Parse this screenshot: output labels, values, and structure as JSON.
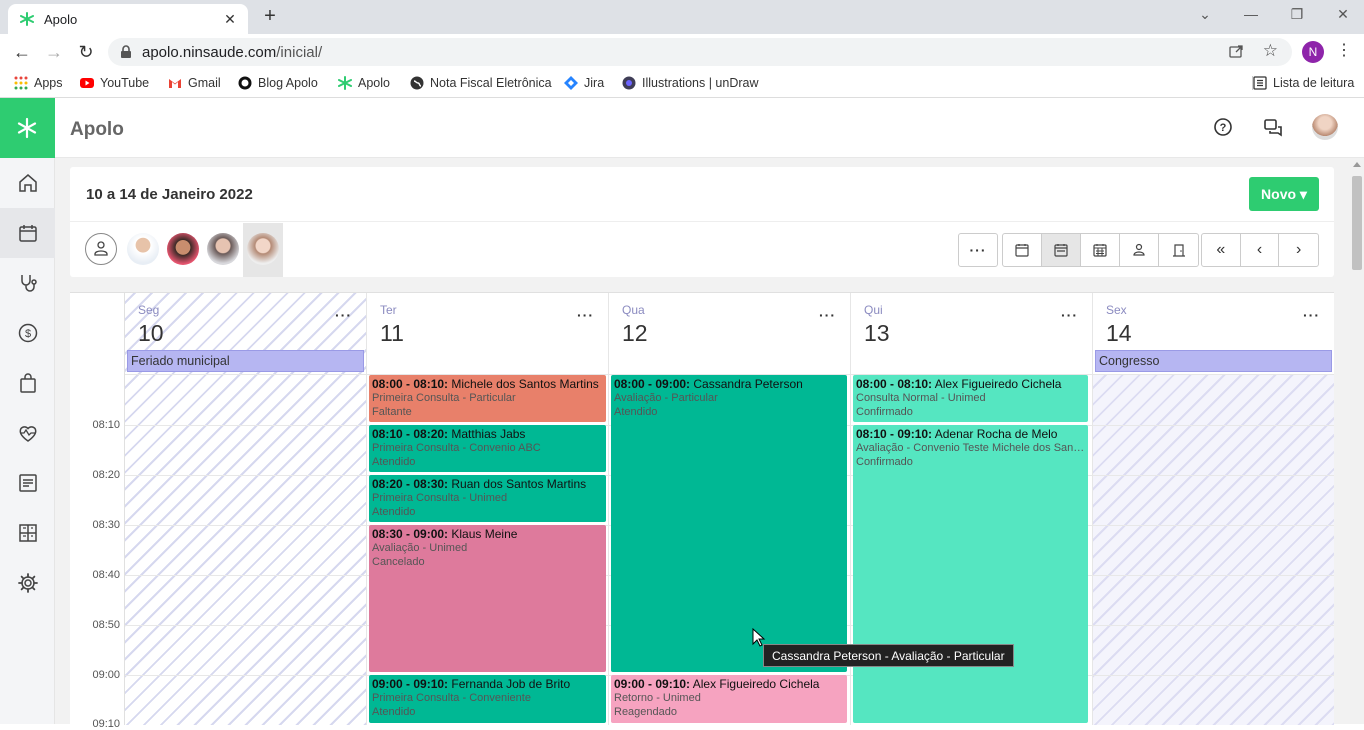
{
  "browser": {
    "tab_title": "Apolo",
    "url_host": "apolo.ninsaude.com",
    "url_path": "/inicial/",
    "profile_initial": "N",
    "bookmarks": [
      "Apps",
      "YouTube",
      "Gmail",
      "Blog Apolo",
      "Apolo",
      "Nota Fiscal Eletrônica",
      "Jira",
      "Illustrations | unDraw"
    ],
    "reading_list": "Lista de leitura"
  },
  "app": {
    "title": "Apolo",
    "brand_color": "#2ecc71"
  },
  "header": {
    "period": "10 a 14 de Janeiro 2022",
    "new_button": "Novo ▾"
  },
  "calendar": {
    "times": [
      "08:10",
      "08:20",
      "08:30",
      "08:40",
      "08:50",
      "09:00",
      "09:10"
    ],
    "days": [
      {
        "name": "Seg",
        "num": "10",
        "allday": "Feriado municipal"
      },
      {
        "name": "Ter",
        "num": "11",
        "allday": ""
      },
      {
        "name": "Qua",
        "num": "12",
        "allday": ""
      },
      {
        "name": "Qui",
        "num": "13",
        "allday": ""
      },
      {
        "name": "Sex",
        "num": "14",
        "allday": "Congresso"
      }
    ],
    "events": [
      {
        "day": 1,
        "time": "08:00 - 08:10:",
        "name": "Michele dos Santos Martins",
        "type": "Primeira Consulta",
        "plan": "Particular",
        "status": "Faltante",
        "color": "#e8806a"
      },
      {
        "day": 1,
        "time": "08:10 - 08:20:",
        "name": "Matthias Jabs",
        "type": "Primeira Consulta",
        "plan": "Convenio ABC",
        "status": "Atendido",
        "color": "#00b894"
      },
      {
        "day": 1,
        "time": "08:20 - 08:30:",
        "name": "Ruan dos Santos Martins",
        "type": "Primeira Consulta",
        "plan": "Unimed",
        "status": "Atendido",
        "color": "#00b894"
      },
      {
        "day": 1,
        "time": "08:30 - 09:00:",
        "name": "Klaus Meine",
        "type": "Avaliação",
        "plan": "Unimed",
        "status": "Cancelado",
        "color": "#de7a9c"
      },
      {
        "day": 1,
        "time": "09:00 - 09:10:",
        "name": "Fernanda Job de Brito",
        "type": "Primeira Consulta",
        "plan": "Conveniente",
        "status": "Atendido",
        "color": "#00b894"
      },
      {
        "day": 2,
        "time": "08:00 - 09:00:",
        "name": "Cassandra Peterson",
        "type": "Avaliação",
        "plan": "Particular",
        "status": "Atendido",
        "color": "#00b894"
      },
      {
        "day": 2,
        "time": "09:00 - 09:10:",
        "name": "Alex Figueiredo Cichela",
        "type": "Retorno",
        "plan": "Unimed",
        "status": "Reagendado",
        "color": "#f6a3c0"
      },
      {
        "day": 3,
        "time": "08:00 - 08:10:",
        "name": "Alex Figueiredo Cichela",
        "type": "Consulta Normal",
        "plan": "Unimed",
        "status": "Confirmado",
        "color": "#55e6c1"
      },
      {
        "day": 3,
        "time": "08:10 - 09:10:",
        "name": "Adenar Rocha de Melo",
        "type": "Avaliação",
        "plan": "Convenio Teste Michele dos Santos Martins",
        "status": "Confirmado",
        "color": "#55e6c1"
      }
    ],
    "tooltip": "Cassandra Peterson - Avaliação - Particular"
  }
}
